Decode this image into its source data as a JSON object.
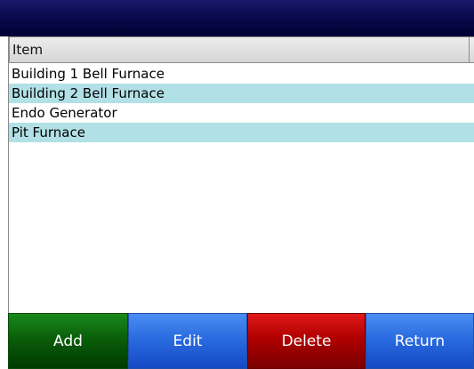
{
  "list": {
    "header": "Item",
    "items": [
      "Building 1 Bell Furnace",
      "Building 2 Bell Furnace",
      "Endo Generator",
      "Pit Furnace"
    ]
  },
  "buttons": {
    "add": "Add",
    "edit": "Edit",
    "delete": "Delete",
    "return": "Return"
  },
  "colors": {
    "title_bar": "#0c0c52",
    "row_highlight": "#b1e0e6",
    "add_button": "#0a5e0a",
    "edit_button": "#2a6be0",
    "delete_button": "#b00000",
    "return_button": "#2a6be0"
  }
}
